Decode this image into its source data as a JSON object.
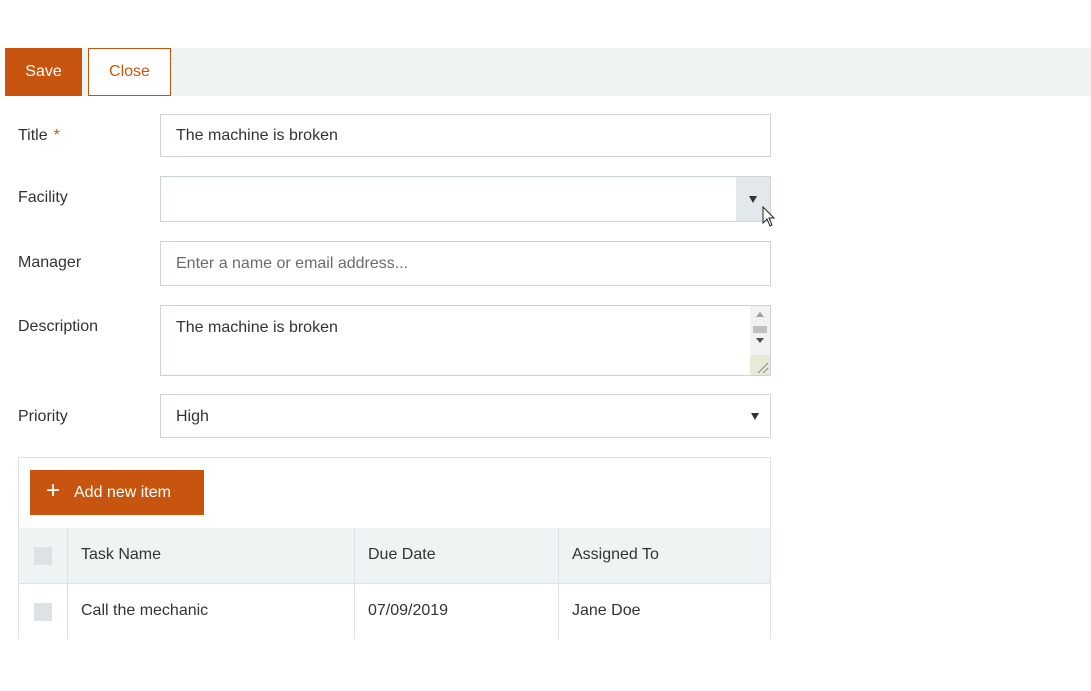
{
  "toolbar": {
    "save_label": "Save",
    "close_label": "Close"
  },
  "form": {
    "title": {
      "label": "Title",
      "required_marker": "*",
      "value": "The machine is broken"
    },
    "facility": {
      "label": "Facility",
      "value": ""
    },
    "manager": {
      "label": "Manager",
      "placeholder": "Enter a name or email address..."
    },
    "description": {
      "label": "Description",
      "value": "The machine is broken"
    },
    "priority": {
      "label": "Priority",
      "value": "High"
    }
  },
  "tasks": {
    "add_label": "Add new item",
    "columns": [
      "Task Name",
      "Due Date",
      "Assigned To"
    ],
    "rows": [
      {
        "task_name": "Call the mechanic",
        "due_date": "07/09/2019",
        "assigned_to": "Jane Doe"
      }
    ]
  },
  "colors": {
    "accent": "#c8550f",
    "toolbar_bg": "#eef4f4",
    "border": "#cbd3d6"
  }
}
